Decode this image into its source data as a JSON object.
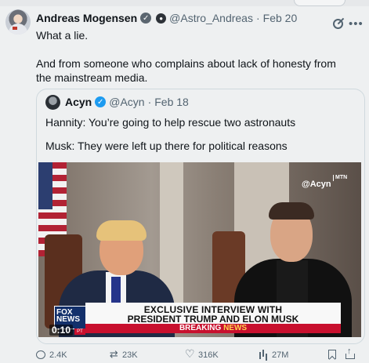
{
  "tweet": {
    "author_name": "Andreas Mogensen",
    "handle": "@Astro_Andreas",
    "separator": "·",
    "date": "Feb 20",
    "text_line1": "What a lie.",
    "text_para2": "And from someone who complains about lack of honesty from the mainstream media."
  },
  "quote": {
    "author_name": "Acyn",
    "handle": "@Acyn",
    "separator": "·",
    "date": "Feb 18",
    "text_line1": "Hannity: You’re going to help rescue two astronauts",
    "text_line2": "Musk: They were left up there for political reasons",
    "video": {
      "watermark": "@Acyn",
      "mtn": "MTN",
      "network_logo": "FOX NEWS",
      "chyron_line1": "EXCLUSIVE INTERVIEW WITH",
      "chyron_line2": "PRESIDENT TRUMP AND ELON MUSK",
      "breaking_word1": "BREAKING",
      "breaking_word2": "NEWS",
      "duration": "0:10",
      "pt_label": "PT"
    }
  },
  "metrics": {
    "replies": "2.4K",
    "reposts": "23K",
    "likes": "316K",
    "views": "27M"
  },
  "icons": {
    "verified": "verified-badge-icon",
    "reply": "reply-icon",
    "repost": "retweet-icon",
    "like": "heart-icon",
    "views": "views-chart-icon",
    "bookmark": "bookmark-icon",
    "share": "share-icon",
    "grok": "grok-icon",
    "more": "more-icon"
  },
  "colors": {
    "accent": "#1d9bf0",
    "muted": "#536471",
    "breaking_red": "#c8102e"
  }
}
